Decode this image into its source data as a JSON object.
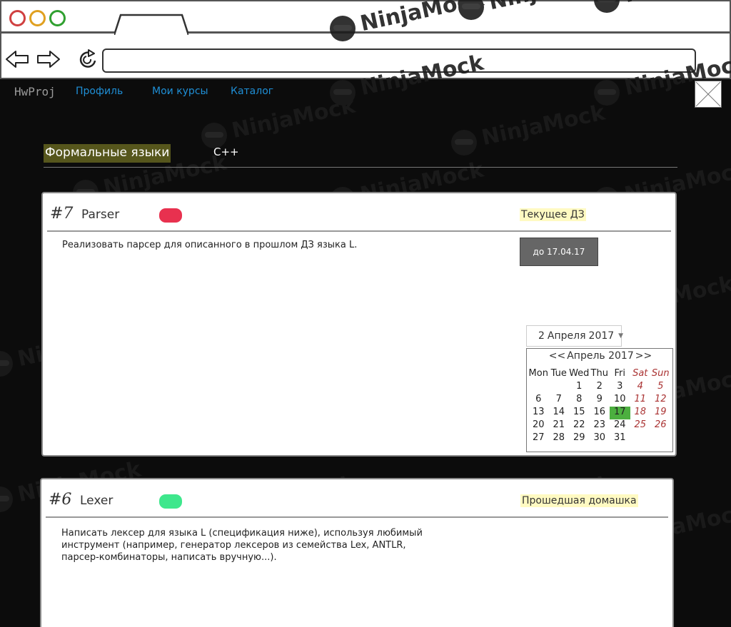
{
  "browser": {
    "url": ""
  },
  "nav": {
    "brand": "HwProj",
    "links": [
      "Профиль",
      "Мои курсы",
      "Каталог"
    ]
  },
  "courses": {
    "active": "Формальные языки",
    "other": "C++"
  },
  "homeworks": [
    {
      "number": "#7",
      "name": "Parser",
      "status_color": "#e8314f",
      "tag": "Текущее ДЗ",
      "description": "Реализовать парсер для описанного в прошлом ДЗ языка L.",
      "deadline": "до 17.04.17",
      "date_select": {
        "day": "2",
        "month": "Апреля",
        "year": "2017"
      },
      "calendar": {
        "title": "Апрель 2017",
        "prev": "<<",
        "next": ">>",
        "weekdays": [
          "Mon",
          "Tue",
          "Wed",
          "Thu",
          "Fri",
          "Sat",
          "Sun"
        ],
        "weeks": [
          [
            "",
            "",
            "1",
            "2",
            "3",
            "4",
            "5"
          ],
          [
            "6",
            "7",
            "8",
            "9",
            "10",
            "11",
            "12"
          ],
          [
            "13",
            "14",
            "15",
            "16",
            "17",
            "18",
            "19"
          ],
          [
            "20",
            "21",
            "22",
            "23",
            "24",
            "25",
            "26"
          ],
          [
            "27",
            "28",
            "29",
            "30",
            "31",
            "",
            ""
          ]
        ],
        "highlighted": "17",
        "highlight_color": "#4caf3f"
      }
    },
    {
      "number": "#6",
      "name": "Lexer",
      "status_color": "#3ee78c",
      "tag": "Прошедшая домашка",
      "description_lines": [
        "Написать лексер для языка L (спецификация ниже), используя любимый",
        "инструмент (например, генератор лексеров из семейства Lex, ANTLR,",
        "парсер-комбинаторы, написать вручную...)."
      ]
    }
  ],
  "watermark_text": "NinjaMock"
}
